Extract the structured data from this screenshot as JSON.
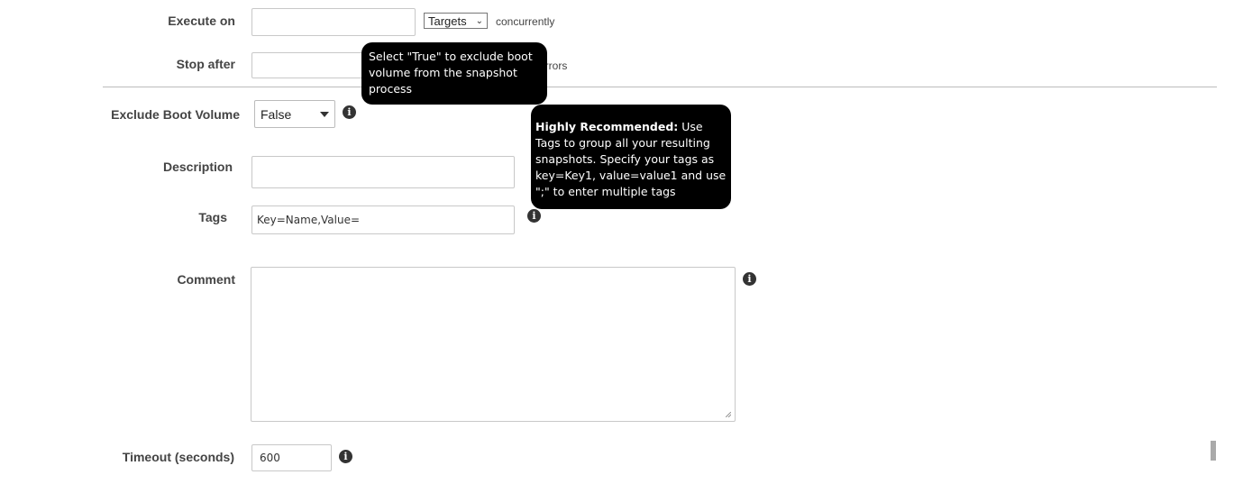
{
  "execute_on": {
    "label": "Execute on",
    "value": "",
    "unit_select": "Targets",
    "suffix": "concurrently"
  },
  "stop_after": {
    "label": "Stop after",
    "value": "",
    "suffix": "errors"
  },
  "exclude_boot_volume": {
    "label": "Exclude Boot Volume",
    "selected": "False",
    "tooltip": "Select \"True\" to exclude boot volume from the snapshot process"
  },
  "description": {
    "label": "Description",
    "value": ""
  },
  "tags": {
    "label": "Tags",
    "value": "Key=Name,Value=",
    "tooltip_bold": "Highly Recommended:",
    "tooltip_text": " Use Tags to group all your resulting snapshots. Specify your tags as key=Key1, value=value1 and use \";\" to enter multiple tags"
  },
  "comment": {
    "label": "Comment",
    "value": ""
  },
  "timeout": {
    "label": "Timeout (seconds)",
    "value": "600"
  },
  "icons": {
    "info": "i"
  }
}
